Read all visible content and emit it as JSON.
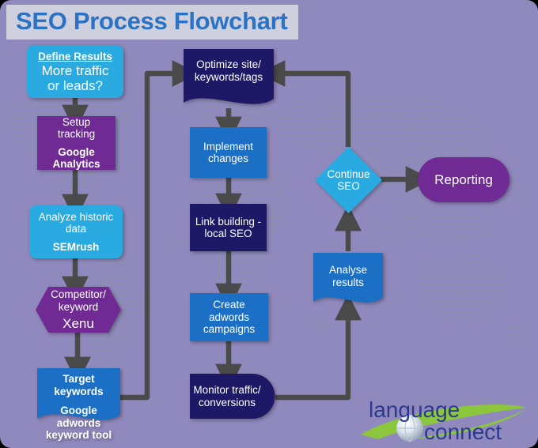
{
  "page": {
    "title": "SEO Process Flowchart",
    "background_color": "#9089bd",
    "title_banner_color": "#cfd0dd",
    "title_text_color": "#2b72c4"
  },
  "palette": {
    "cyan": "#29abe2",
    "blue": "#1b6fc4",
    "navy": "#1e1966",
    "purple": "#6f2a94",
    "arrow": "#4a4a4a",
    "map_dots": "#8a8fb0",
    "logo_text": "#2b3a8f",
    "logo_swoosh": "#8cc63f"
  },
  "nodes": {
    "define_results": {
      "heading": "Define Results",
      "line1": "More traffic",
      "line2": "or leads?",
      "shape": "rounded-rectangle",
      "color": "#29abe2"
    },
    "setup_tracking": {
      "line1": "Setup",
      "line2": "tracking",
      "tool": "Google",
      "tool2": "Analytics",
      "shape": "rectangle",
      "color": "#6f2a94"
    },
    "analyze_historic": {
      "line1": "Analyze historic",
      "line2": "data",
      "tool": "SEMrush",
      "shape": "rounded-rectangle",
      "color": "#29abe2"
    },
    "competitor_keyword": {
      "line1": "Competitor/",
      "line2": "keyword",
      "tool": "Xenu",
      "shape": "hexagon",
      "color": "#6f2a94"
    },
    "target_keywords": {
      "line1": "Target keywords",
      "tool": "Google adwords",
      "tool2": "keyword tool",
      "shape": "document-wave",
      "color": "#1b6fc4"
    },
    "optimize_site": {
      "line1": "Optimize site/",
      "line2": "keywords/tags",
      "shape": "document-wave",
      "color": "#1e1966"
    },
    "implement_changes": {
      "line1": "Implement",
      "line2": "changes",
      "shape": "rectangle",
      "color": "#1b6fc4"
    },
    "link_building": {
      "line1": "Link building -",
      "line2": "local SEO",
      "shape": "rectangle",
      "color": "#1e1966"
    },
    "create_adwords": {
      "line1": "Create adwords",
      "line2": "campaigns",
      "shape": "rectangle",
      "color": "#1b6fc4"
    },
    "monitor_traffic": {
      "line1": "Monitor traffic/",
      "line2": "conversions",
      "shape": "rounded-right-rectangle",
      "color": "#1e1966"
    },
    "analyse_results": {
      "line1": "Analyse",
      "line2": "results",
      "shape": "document-wave",
      "color": "#1b6fc4"
    },
    "continue_seo": {
      "line1": "Continue",
      "line2": "SEO",
      "shape": "diamond",
      "color": "#29abe2"
    },
    "reporting": {
      "line1": "Reporting",
      "shape": "oval",
      "color": "#6f2a94"
    }
  },
  "logo": {
    "word1": "language",
    "word2": "connect"
  }
}
